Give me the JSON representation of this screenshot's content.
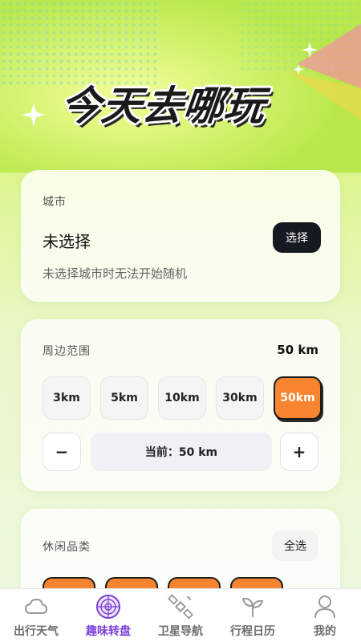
{
  "hero": {
    "title": "今天去哪玩"
  },
  "city_card": {
    "label": "城市",
    "value": "未选择",
    "button": "选择",
    "hint": "未选择城市时无法开始随机"
  },
  "range_card": {
    "label": "周边范围",
    "value": "50 km",
    "options": [
      "3km",
      "5km",
      "10km",
      "30km",
      "50km"
    ],
    "selected": "50km",
    "minus": "−",
    "plus": "+",
    "current": "当前：50 km"
  },
  "category_card": {
    "label": "休闲品类",
    "select_all": "全选"
  },
  "tabs": [
    {
      "label": "出行天气",
      "icon": "cloud-icon"
    },
    {
      "label": "趣味转盘",
      "icon": "wheel-icon",
      "active": true
    },
    {
      "label": "卫星导航",
      "icon": "satellite-icon"
    },
    {
      "label": "行程日历",
      "icon": "sprout-icon"
    },
    {
      "label": "我的",
      "icon": "person-icon"
    }
  ],
  "colors": {
    "accent": "#f7842f",
    "active_tab": "#7b3fd8",
    "dark_button": "#151a22"
  }
}
